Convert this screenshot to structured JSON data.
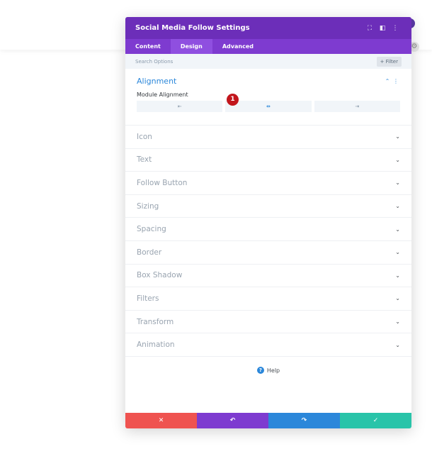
{
  "background": {
    "dot_color": "#5b3aa7",
    "gear_icon": "gear-icon"
  },
  "modal": {
    "title": "Social Media Follow Settings",
    "header_icons": [
      "expand-icon",
      "split-view-icon",
      "more-icon"
    ],
    "colors": {
      "header": "#6c2eb9",
      "tabs": "#7e3bd0",
      "active_tab": "#8f4fe0",
      "accent": "#2b87da"
    },
    "tabs": [
      {
        "label": "Content",
        "active": false
      },
      {
        "label": "Design",
        "active": true
      },
      {
        "label": "Advanced",
        "active": false
      }
    ],
    "search": {
      "placeholder": "Search Options",
      "filter_label": "+ Filter"
    },
    "alignment": {
      "title": "Alignment",
      "field_label": "Module Alignment",
      "options": [
        "left",
        "center",
        "right"
      ],
      "selected": "center",
      "badge": "1"
    },
    "sections": [
      "Icon",
      "Text",
      "Follow Button",
      "Sizing",
      "Spacing",
      "Border",
      "Box Shadow",
      "Filters",
      "Transform",
      "Animation"
    ],
    "help_label": "Help",
    "footer": {
      "buttons": [
        {
          "name": "cancel",
          "icon": "close-icon",
          "glyph": "✕",
          "color": "#ef5350"
        },
        {
          "name": "undo",
          "icon": "undo-icon",
          "glyph": "↶",
          "color": "#7e3bd0"
        },
        {
          "name": "redo",
          "icon": "redo-icon",
          "glyph": "↷",
          "color": "#2b87da"
        },
        {
          "name": "save",
          "icon": "check-icon",
          "glyph": "✓",
          "color": "#29c4a9"
        }
      ]
    }
  }
}
